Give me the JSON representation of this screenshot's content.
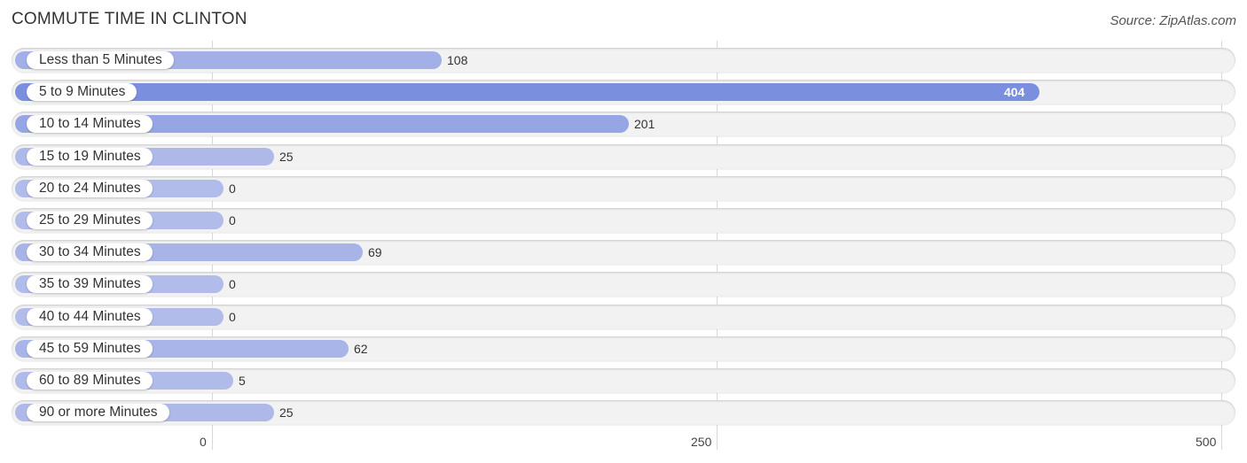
{
  "chart_data": {
    "type": "bar",
    "orientation": "horizontal",
    "title": "COMMUTE TIME IN CLINTON",
    "source": "Source: ZipAtlas.com",
    "categories": [
      "Less than 5 Minutes",
      "5 to 9 Minutes",
      "10 to 14 Minutes",
      "15 to 19 Minutes",
      "20 to 24 Minutes",
      "25 to 29 Minutes",
      "30 to 34 Minutes",
      "35 to 39 Minutes",
      "40 to 44 Minutes",
      "45 to 59 Minutes",
      "60 to 89 Minutes",
      "90 or more Minutes"
    ],
    "values": [
      108,
      404,
      201,
      25,
      0,
      0,
      69,
      0,
      0,
      62,
      5,
      25
    ],
    "xlabel": "",
    "ylabel": "",
    "xlim": [
      0,
      500
    ],
    "xticks": [
      0,
      250,
      500
    ],
    "xtick_labels": [
      "0",
      "250",
      "500"
    ],
    "grid": true,
    "legend": "none",
    "colors": {
      "max": "#7b8fdf",
      "min": "#b1bcea",
      "track": "#f2f2f2"
    }
  }
}
